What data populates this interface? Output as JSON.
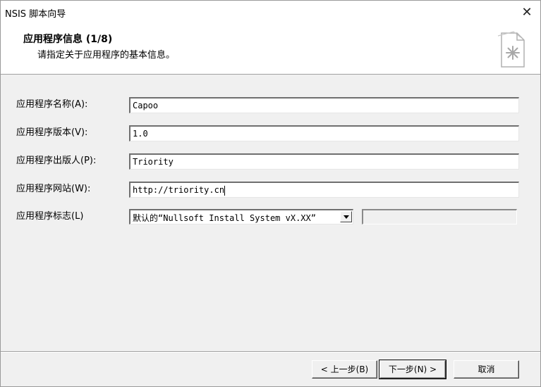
{
  "window": {
    "title": "NSIS 脚本向导",
    "close_glyph": "✕"
  },
  "header": {
    "title": "应用程序信息 (1/8)",
    "subtitle": "请指定关于应用程序的基本信息。",
    "icon": "wizard-document-icon"
  },
  "form": {
    "name_label": "应用程序名称(A):",
    "name_value": "Capoo",
    "version_label": "应用程序版本(V):",
    "version_value": "1.0",
    "publisher_label": "应用程序出版人(P):",
    "publisher_value": "Triority",
    "website_label": "应用程序网站(W):",
    "website_value": "http://triority.cn",
    "branding_label": "应用程序标志(L)",
    "branding_selected": "默认的“Nullsoft Install System vX.XX”",
    "branding_custom_value": ""
  },
  "footer": {
    "back_label": "< 上一步(B)",
    "next_label": "下一步(N) >",
    "cancel_label": "取消"
  }
}
